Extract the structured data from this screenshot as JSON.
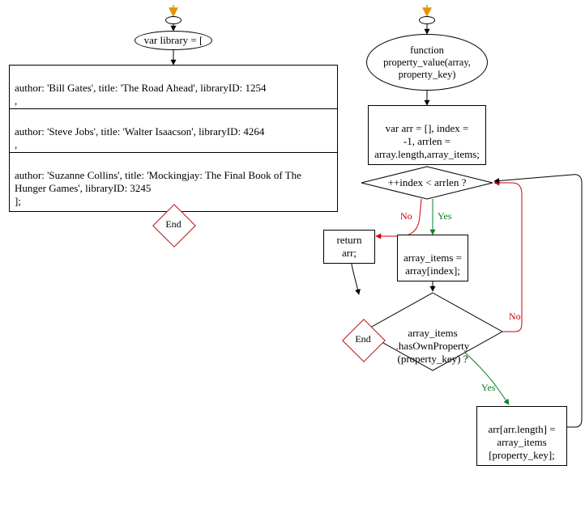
{
  "left": {
    "start": "var library = [",
    "items": [
      "author: 'Bill Gates', title: 'The Road Ahead', libraryID: 1254\n,",
      "author: 'Steve Jobs', title: 'Walter Isaacson', libraryID: 4264\n,",
      "author: 'Suzanne Collins', title: 'Mockingjay: The Final Book of The Hunger Games', libraryID: 3245\n];"
    ],
    "end": "End"
  },
  "right": {
    "func": "function\nproperty_value(array,\nproperty_key)",
    "init": "var arr = [], index =\n-1, arrlen =\narray.length,array_items;",
    "cond1": "++index < arrlen ?",
    "assign": "array_items =\narray[index];",
    "ret": "return arr;",
    "cond2": "array_items\n.hasOwnProperty\n(property_key) ?",
    "push": "arr[arr.length] =\narray_items\n[property_key];",
    "end": "End",
    "yes": "Yes",
    "no": "No"
  },
  "chart_data": [
    {
      "type": "flowchart",
      "title": "library declaration",
      "nodes": [
        {
          "id": "L-entry",
          "shape": "small-ellipse",
          "text": ""
        },
        {
          "id": "L-start",
          "shape": "ellipse",
          "text": "var library = ["
        },
        {
          "id": "L-item0",
          "shape": "process",
          "text": "author: 'Bill Gates', title: 'The Road Ahead', libraryID: 1254 ,"
        },
        {
          "id": "L-item1",
          "shape": "process",
          "text": "author: 'Steve Jobs', title: 'Walter Isaacson', libraryID: 4264 ,"
        },
        {
          "id": "L-item2",
          "shape": "process",
          "text": "author: 'Suzanne Collins', title: 'Mockingjay: The Final Book of The Hunger Games', libraryID: 3245 ];"
        },
        {
          "id": "L-end",
          "shape": "terminator",
          "text": "End"
        }
      ],
      "edges": [
        {
          "from": "L-entry",
          "to": "L-start"
        },
        {
          "from": "L-start",
          "to": "L-item0"
        },
        {
          "from": "L-item0",
          "to": "L-item1"
        },
        {
          "from": "L-item1",
          "to": "L-item2"
        },
        {
          "from": "L-item2",
          "to": "L-end"
        }
      ]
    },
    {
      "type": "flowchart",
      "title": "property_value function",
      "nodes": [
        {
          "id": "R-entry",
          "shape": "small-ellipse",
          "text": ""
        },
        {
          "id": "R-func",
          "shape": "ellipse",
          "text": "function property_value(array, property_key)"
        },
        {
          "id": "R-init",
          "shape": "process",
          "text": "var arr = [], index = -1, arrlen = array.length,array_items;"
        },
        {
          "id": "R-cond1",
          "shape": "decision",
          "text": "++index < arrlen ?"
        },
        {
          "id": "R-assign",
          "shape": "process",
          "text": "array_items = array[index];"
        },
        {
          "id": "R-ret",
          "shape": "process",
          "text": "return arr;"
        },
        {
          "id": "R-cond2",
          "shape": "decision",
          "text": "array_items .hasOwnProperty (property_key) ?"
        },
        {
          "id": "R-push",
          "shape": "process",
          "text": "arr[arr.length] = array_items [property_key];"
        },
        {
          "id": "R-end",
          "shape": "terminator",
          "text": "End"
        }
      ],
      "edges": [
        {
          "from": "R-entry",
          "to": "R-func"
        },
        {
          "from": "R-func",
          "to": "R-init"
        },
        {
          "from": "R-init",
          "to": "R-cond1"
        },
        {
          "from": "R-cond1",
          "to": "R-assign",
          "label": "Yes"
        },
        {
          "from": "R-cond1",
          "to": "R-ret",
          "label": "No"
        },
        {
          "from": "R-assign",
          "to": "R-cond2"
        },
        {
          "from": "R-cond2",
          "to": "R-push",
          "label": "Yes"
        },
        {
          "from": "R-cond2",
          "to": "R-cond1",
          "label": "No"
        },
        {
          "from": "R-push",
          "to": "R-cond1"
        },
        {
          "from": "R-ret",
          "to": "R-end"
        }
      ]
    }
  ]
}
